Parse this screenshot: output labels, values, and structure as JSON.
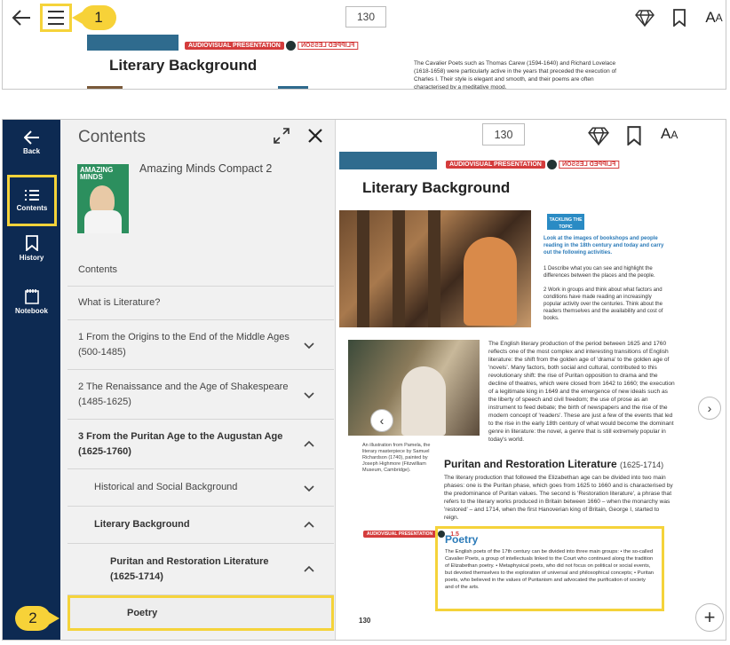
{
  "step1": {
    "page_number": "130",
    "callout": "1",
    "av_tag": {
      "red": "AUDIOVISUAL PRESENTATION",
      "flip": "FLIPPED LESSON"
    },
    "heading": "Literary Background",
    "para": "The Cavalier Poets such as Thomas Carew (1594-1640) and Richard Lovelace (1618-1658) were particularly active in the years that preceded the execution of Charles I. Their style is elegant and smooth, and their poems are often characterised by a meditative mood."
  },
  "rail": {
    "back": "Back",
    "contents": "Contents",
    "history": "History",
    "notebook": "Notebook",
    "callout": "2"
  },
  "panel": {
    "title": "Contents",
    "book_title": "Amazing Minds Compact 2",
    "cover_title": "AMAZING MINDS",
    "items": [
      "Contents",
      "What is Literature?",
      "1 From the Origins to the End of the Middle Ages (500-1485)",
      "2 The Renaissance and the Age of Shakespeare (1485-1625)",
      "3 From the Puritan Age to the Augustan Age (1625-1760)",
      "Historical and Social Background",
      "Literary Background",
      "Puritan and Restoration Literature (1625-1714)",
      "Poetry"
    ]
  },
  "viewer": {
    "page_number": "130",
    "nav_prev": "‹",
    "nav_next": "›",
    "add": "+",
    "page": {
      "av_tag": {
        "red": "AUDIOVISUAL PRESENTATION",
        "flip": "FLIPPED LESSON"
      },
      "heading": "Literary Background",
      "tackling_tag": "TACKLING THE TOPIC",
      "tackling_intro": "Look at the images of bookshops and people reading in the 18th century and today and carry out the following activities.",
      "q1": "1  Describe what you can see and highlight the differences between the places and the people.",
      "q2": "2  Work in groups and think about what factors and conditions have made reading an increasingly popular activity over the centuries. Think about the readers themselves and the availability and cost of books.",
      "caption": "An illustration from Pamela, the literary masterpiece by Samuel Richardson (1740), painted by Joseph Highmore (Fitzwilliam Museum, Cambridge).",
      "body": "The English literary production of the period between 1625 and 1760 reflects one of the most complex and interesting transitions of English literature: the shift from the golden age of 'drama' to the golden age of 'novels'. Many factors, both social and cultural, contributed to this revolutionary shift: the rise of Puritan opposition to drama and the decline of theatres, which were closed from 1642 to 1660; the execution of a legitimate king in 1649 and the emergence of new ideals such as the liberty of speech and civil freedom; the use of prose as an instrument to feed debate; the birth of newspapers and the rise of the modern concept of 'readers'. These are just a few of the events that led to the rise in the early 18th century of what would become the dominant genre in literature: the novel, a genre that is still extremely popular in today's world.",
      "sub_heading": "Puritan and Restoration Literature",
      "sub_years": "(1625-1714)",
      "sub_text": "The literary production that followed the Elizabethan age can be divided into two main phases: one is the Puritan phase, which goes from 1625 to 1660 and is characterised by the predominance of Puritan values. The second is 'Restoration literature', a phrase that refers to the literary works produced in Britain between 1660 – when the monarchy was 'restored' – and 1714, when the first Hanoverian king of Britain, George I, started to reign.",
      "av_small": "AUDIOVISUAL PRESENTATION",
      "av_small_num": "1.5",
      "poetry_heading": "Poetry",
      "poetry_text": "The English poets of the 17th century can be divided into three main groups: • the so-called Cavalier Poets, a group of intellectuals linked to the Court who continued along the tradition of Elizabethan poetry. • Metaphysical poets, who did not focus on political or social events, but devoted themselves to the exploration of universal and philosophical concepts; • Puritan poets, who believed in the values of Puritanism and advocated the purification of society and of the arts.",
      "page_num": "130"
    }
  },
  "colors": {
    "rail": "#0d2a52",
    "highlight": "#f5d33a",
    "accent": "#2a7ab8"
  }
}
